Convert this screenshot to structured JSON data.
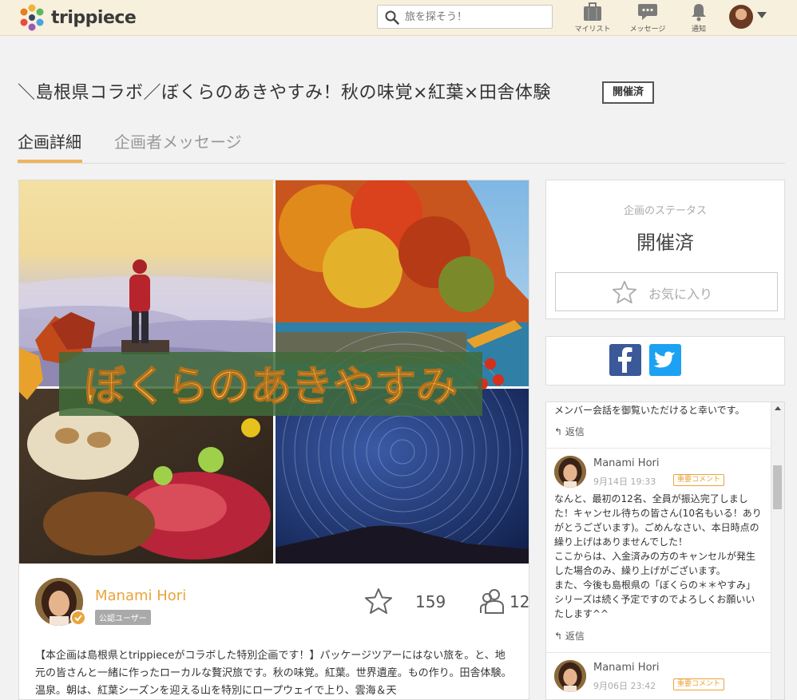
{
  "header": {
    "logo_text": "trippiece",
    "search_placeholder": "旅を探そう！",
    "nav": [
      {
        "label": "マイリスト",
        "icon": "suitcase-icon"
      },
      {
        "label": "メッセージ",
        "icon": "chat-bubble-icon"
      },
      {
        "label": "通知",
        "icon": "bell-icon"
      }
    ]
  },
  "page": {
    "title": "＼島根県コラボ／ぼくらのあきやすみ！秋の味覚×紅葉×田舎体験",
    "status_badge": "開催済"
  },
  "tabs": [
    {
      "label": "企画詳細",
      "active": true
    },
    {
      "label": "企画者メッセージ",
      "active": false
    }
  ],
  "hero": {
    "overlay_text": "ぼくらのあきやすみ"
  },
  "organizer": {
    "name": "Manami Hori",
    "role": "公認ユーザー",
    "likes": "159",
    "members": "12"
  },
  "description": "【本企画は島根県とtrippieceがコラボした特別企画です！】パッケージツアーにはない旅を。と、地元の皆さんと一緒に作ったローカルな贅沢旅です。秋の味覚。紅葉。世界遺産。もの作り。田舎体験。温泉。朝は、紅葉シーズンを迎える山を特別にロープウェイで上り、雲海＆天",
  "status_card": {
    "label": "企画のステータス",
    "value": "開催済",
    "favorite_label": "お気に入り"
  },
  "comments": {
    "top_text": "メンバー会話を御覧いただけると幸いです。",
    "reply_label": "返信",
    "items": [
      {
        "author": "Manami Hori",
        "date": "9月14日 19:33",
        "tag": "重要コメント",
        "lines": [
          "なんと、最初の12名、全員が振込完了しまし",
          "た！キャンセル待ちの皆さん(10名もいる！あり",
          "がとうございます)。ごめんなさい、本日時点の",
          "繰り上げはありませんでした！",
          "ここからは、入金済みの方のキャンセルが発生",
          "した場合のみ、繰り上げがございます。",
          "また、今後も島根県の「ぼくらの＊＊やすみ」",
          "シリーズは続く予定ですのでよろしくお願いい",
          "たします^^"
        ]
      },
      {
        "author": "Manami Hori",
        "date": "9月06日 23:42",
        "tag": "重要コメント",
        "lines": []
      }
    ]
  },
  "colors": {
    "topbar_bg": "#f7f0dd",
    "accent_orange": "#e9a43a",
    "tab_underline": "#f0b45c",
    "facebook": "#3b5998",
    "twitter": "#1da1f2"
  }
}
